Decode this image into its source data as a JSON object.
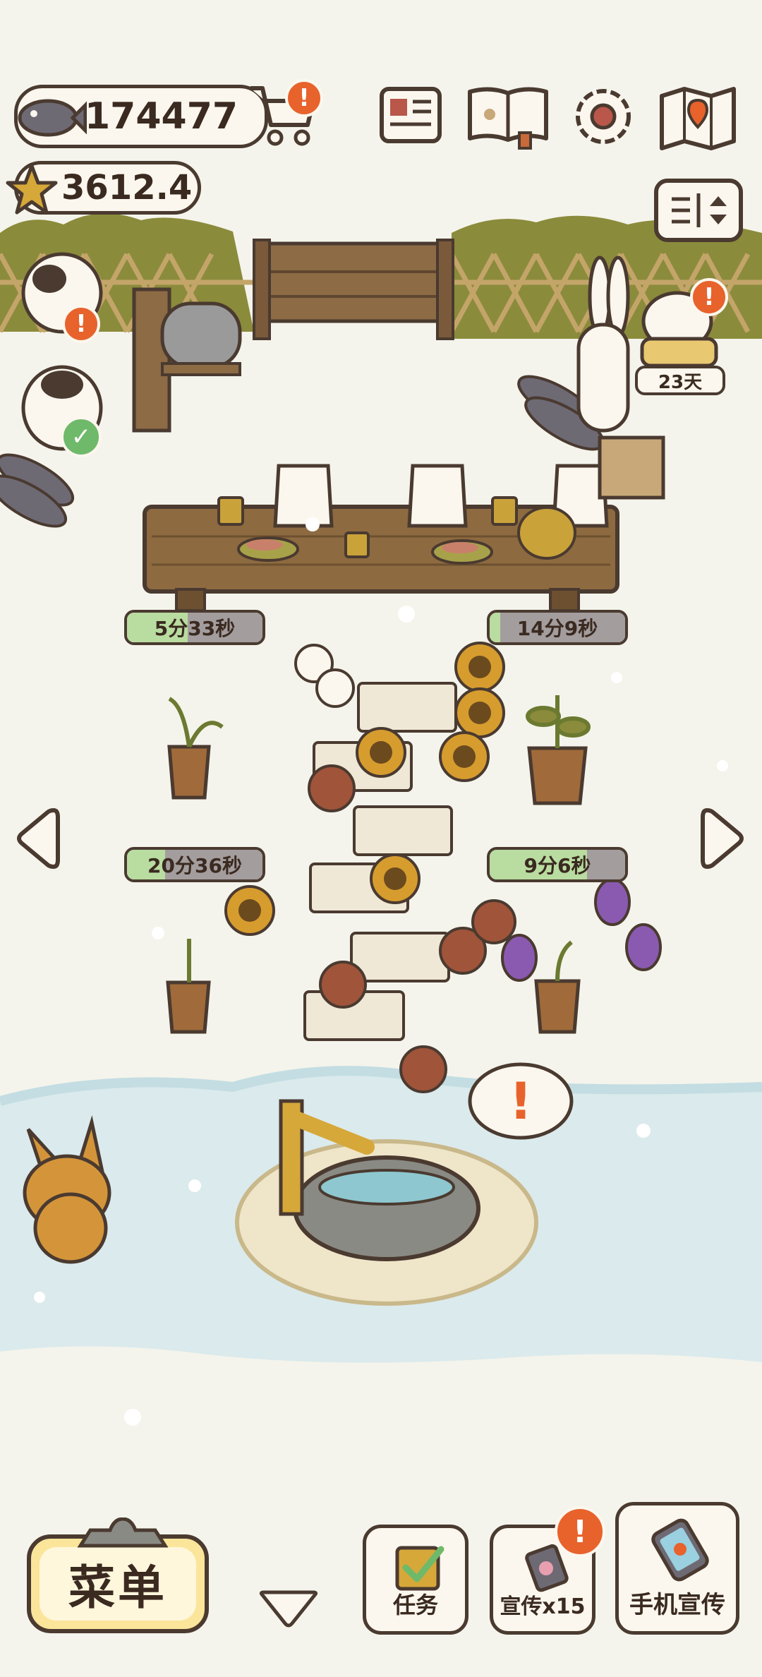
{
  "currency": {
    "fish": "174477",
    "stars": "3612.4"
  },
  "top_icons": [
    "newspaper-icon",
    "paw-book-icon",
    "gear-icon",
    "map-icon"
  ],
  "visitor": {
    "days_label": "23天"
  },
  "timers": [
    {
      "label": "5分33秒",
      "progress": 0.45
    },
    {
      "label": "14分9秒",
      "progress": 0.08
    },
    {
      "label": "20分36秒",
      "progress": 0.28
    },
    {
      "label": "9分6秒",
      "progress": 0.72
    }
  ],
  "bottom": {
    "menu_label": "菜单",
    "tasks_label": "任务",
    "promo_label": "宣传x15",
    "phone_promo_label": "手机宣传"
  },
  "colors": {
    "accent": "#e8622c",
    "ok": "#6fb96a",
    "timer_fill": "#b9dca0",
    "menu_yellow": "#fbe59a"
  }
}
